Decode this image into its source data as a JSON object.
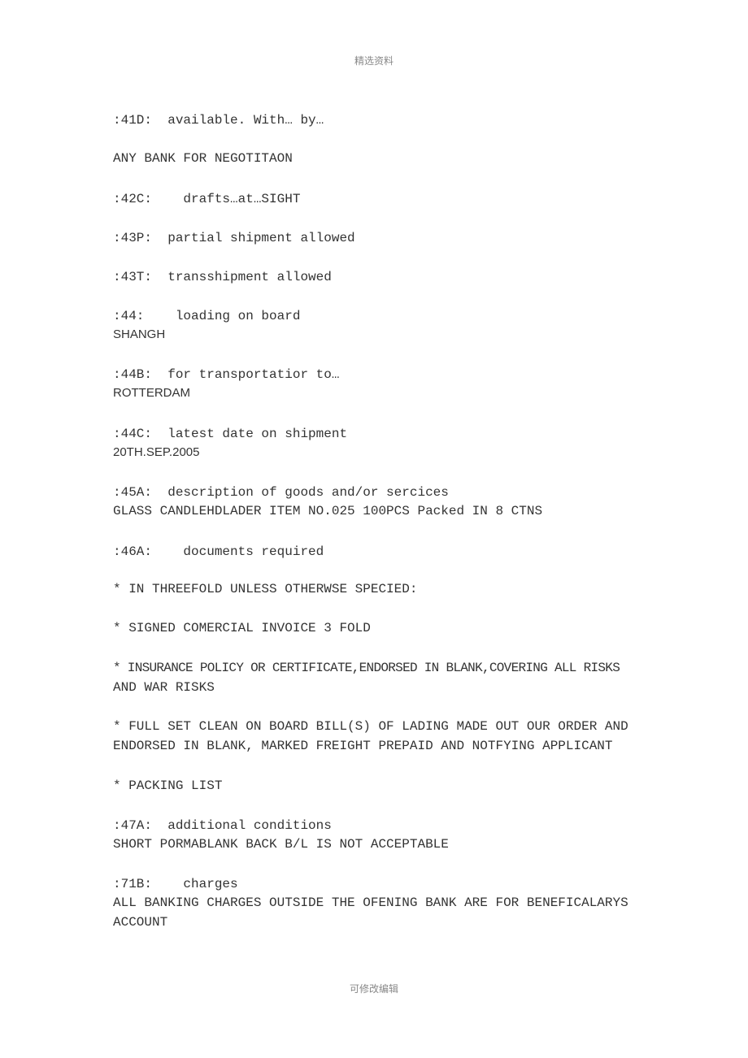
{
  "header": "精选资料",
  "footer": "可修改编辑",
  "lines": [
    ":41D:  available. With… by…",
    "ANY BANK FOR NEGOTITAON",
    ":42C:    drafts…at…SIGHT",
    ":43P:  partial shipment allowed",
    ":43T:  transshipment allowed",
    ":44:    loading on board",
    "SHANGH",
    ":44B:  for transportatior to…",
    "ROTTERDAM",
    ":44C:  latest date on shipment",
    "20TH.SEP.2005",
    ":45A:  description of goods and/or sercices",
    "GLASS CANDLEHDLADER ITEM NO.025 100PCS Packed IN 8 CTNS",
    ":46A:    documents required",
    "* IN THREEFOLD UNLESS OTHERWSE SPECIED:",
    "* SIGNED COMERCIAL INVOICE 3 FOLD",
    "* INSURANCE POLICY OR CERTIFICATE,ENDORSED IN BLANK,COVERING ALL RISKS",
    "AND WAR RISKS",
    "* FULL SET CLEAN ON BOARD BILL(S) OF LADING MADE OUT OUR ORDER AND",
    "ENDORSED IN BLANK, MARKED FREIGHT PREPAID AND NOTFYING APPLICANT",
    "* PACKING LIST",
    ":47A:  additional conditions",
    "SHORT PORMABLANK BACK B/L IS NOT ACCEPTABLE",
    ":71B:    charges",
    "ALL BANKING CHARGES OUTSIDE THE OFENING BANK ARE FOR BENEFICALARYS",
    "ACCOUNT"
  ]
}
